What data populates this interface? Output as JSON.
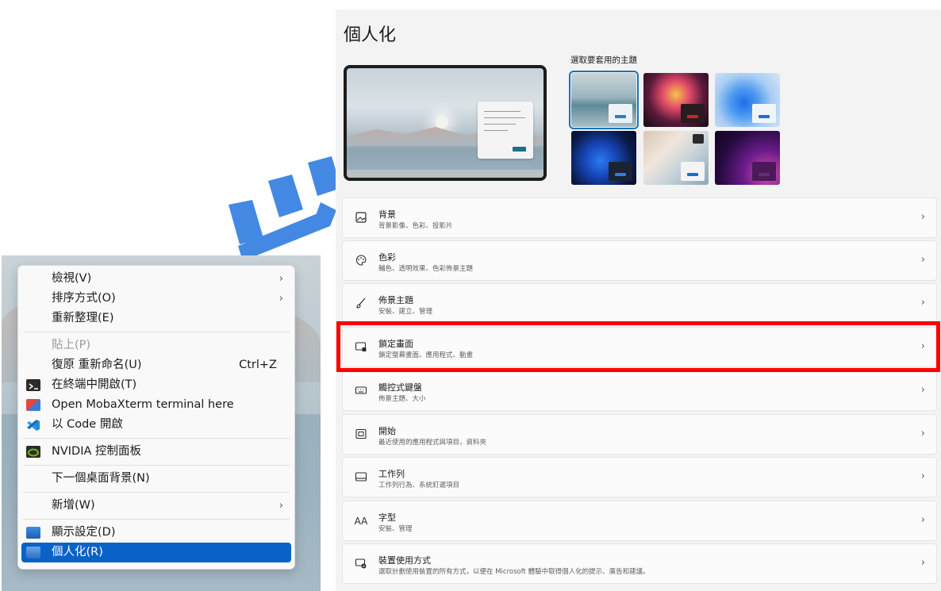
{
  "context_menu": {
    "items": [
      {
        "label": "檢視(V)",
        "arrow": "›"
      },
      {
        "label": "排序方式(O)",
        "arrow": "›"
      },
      {
        "label": "重新整理(E)"
      },
      {
        "label": "貼上(P)"
      },
      {
        "label": "復原 重新命名(U)",
        "shortcut": "Ctrl+Z"
      },
      {
        "label": "在終端中開啟(T)"
      },
      {
        "label": "Open MobaXterm terminal here"
      },
      {
        "label": "以 Code 開啟"
      },
      {
        "label": "NVIDIA 控制面板"
      },
      {
        "label": "下一個桌面背景(N)"
      },
      {
        "label": "新增(W)",
        "arrow": "›"
      },
      {
        "label": "顯示設定(D)"
      },
      {
        "label": "個人化(R)"
      }
    ]
  },
  "settings": {
    "page_title": "個人化",
    "themes_label": "選取要套用的主題",
    "rows": [
      {
        "title": "背景",
        "desc": "背景影像、色彩、投影片",
        "icon": "image-icon"
      },
      {
        "title": "色彩",
        "desc": "輔色、透明效果、色彩佈景主題",
        "icon": "palette-icon"
      },
      {
        "title": "佈景主題",
        "desc": "安裝、建立、管理",
        "icon": "brush-icon"
      },
      {
        "title": "鎖定畫面",
        "desc": "鎖定螢幕畫面、應用程式、動畫",
        "icon": "lock-screen-icon"
      },
      {
        "title": "觸控式鍵盤",
        "desc": "佈景主題、大小",
        "icon": "keyboard-icon"
      },
      {
        "title": "開始",
        "desc": "最近使用的應用程式與項目，資料夾",
        "icon": "start-icon"
      },
      {
        "title": "工作列",
        "desc": "工作列行為、系統釘選項目",
        "icon": "taskbar-icon"
      },
      {
        "title": "字型",
        "desc": "安裝、管理",
        "icon": "font-icon"
      },
      {
        "title": "裝置使用方式",
        "desc": "選取計劃使用裝置的所有方式，以便在 Microsoft 體驗中取得個人化的提示、廣告和建議。",
        "icon": "device-usage-icon"
      }
    ],
    "chevron": "›",
    "font_icon_glyph": "AA"
  },
  "colors": {
    "accent": "#0a62c9",
    "highlight": "#ff0000",
    "watermark": "#2f7de1"
  }
}
